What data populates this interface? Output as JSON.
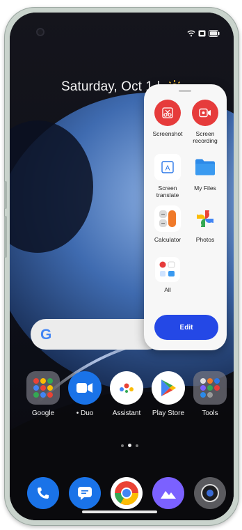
{
  "homescreen": {
    "date": "Saturday, Oct 1 |",
    "search_logo": "G"
  },
  "apps": [
    {
      "name": "google-folder",
      "label": "Google"
    },
    {
      "name": "duo",
      "label": "• Duo"
    },
    {
      "name": "assistant",
      "label": "Assistant"
    },
    {
      "name": "play-store",
      "label": "Play Store"
    },
    {
      "name": "tools-folder",
      "label": "Tools"
    }
  ],
  "dock": [
    {
      "name": "phone-icon"
    },
    {
      "name": "messages-icon"
    },
    {
      "name": "chrome-icon"
    },
    {
      "name": "gallery-icon"
    },
    {
      "name": "camera-icon"
    }
  ],
  "panel": {
    "items": [
      {
        "label": "Screenshot",
        "icon": "scissors-icon",
        "color": "#e63b3b"
      },
      {
        "label": "Screen recording",
        "icon": "video-record-icon",
        "color": "#e63b3b"
      },
      {
        "label": "Screen translate",
        "icon": "translate-icon",
        "color": "#2c78e8"
      },
      {
        "label": "My Files",
        "icon": "folder-icon",
        "color": "#2c8ae8"
      },
      {
        "label": "Calculator",
        "icon": "calculator-icon",
        "color": "#f07a2a"
      },
      {
        "label": "Photos",
        "icon": "photos-pinwheel-icon",
        "color": "#34a853"
      },
      {
        "label": "All",
        "icon": "all-apps-grid-icon",
        "color": "#e63b3b"
      }
    ],
    "edit_label": "Edit"
  },
  "colors": {
    "accent": "#2448e6",
    "red": "#e63b3b"
  }
}
